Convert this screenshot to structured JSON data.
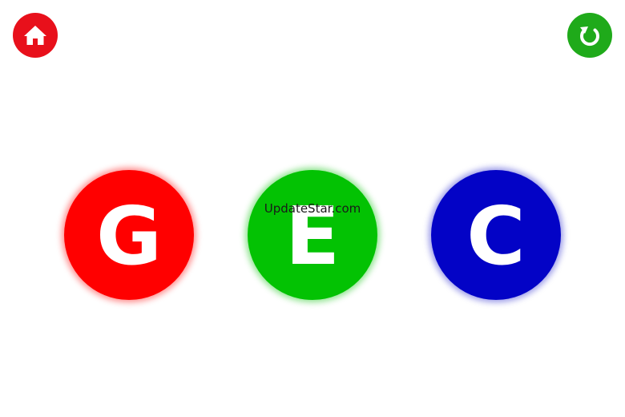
{
  "toolbar": {
    "home_icon": "home-icon",
    "restart_icon": "restart-icon",
    "home_color": "#e8101b",
    "restart_color": "#1faa1a"
  },
  "balls": [
    {
      "letter": "G",
      "color": "#ff0000"
    },
    {
      "letter": "E",
      "color": "#03c203"
    },
    {
      "letter": "C",
      "color": "#0303c6"
    }
  ],
  "watermark": "UpdateStar.com"
}
